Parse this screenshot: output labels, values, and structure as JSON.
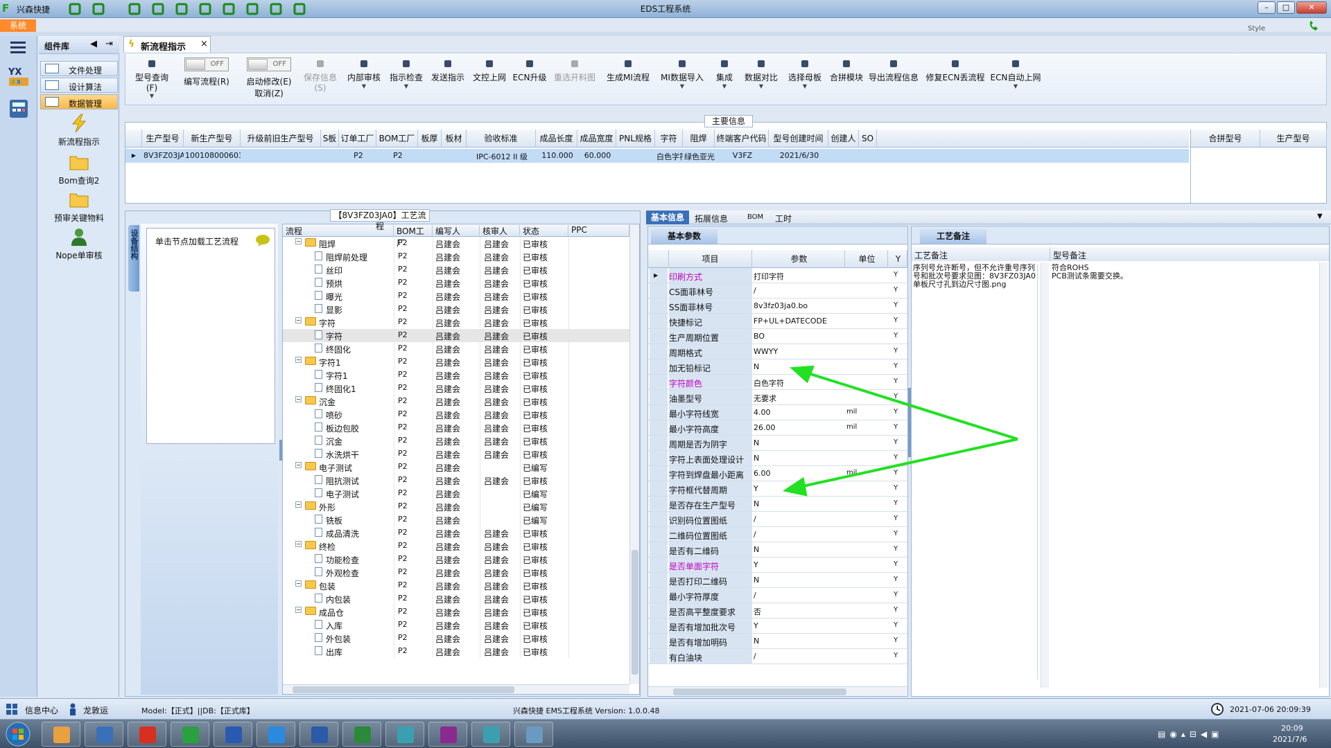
{
  "titlebar": {
    "app_name": "兴森快捷",
    "window_title": "EDS工程系统",
    "style_label": "Style",
    "buttons": [
      "–",
      "□",
      "✕"
    ]
  },
  "quick_icons": [
    "search-icon",
    "target-icon",
    "table-icon",
    "scissors-icon",
    "film-icon",
    "tree-icon",
    "grid-icon",
    "user-icon",
    "chart-icon",
    "monitor-icon"
  ],
  "system_tab": "系统",
  "nav": {
    "header": "组件库",
    "items": [
      "文件处理",
      "设计算法",
      "数据管理"
    ],
    "big_items": [
      "新流程指示",
      "Bom查询2",
      "预审关键物料",
      "Nope单审核"
    ]
  },
  "doc_tab": {
    "label": "新流程指示",
    "close": "×"
  },
  "toolbar": {
    "buttons": [
      {
        "label": "型号查询(F)",
        "icon": "search-icon",
        "dropdown": true
      },
      {
        "label": "编写流程(R)",
        "toggle": "OFF"
      },
      {
        "label": "启动修改(E)",
        "toggle": "OFF",
        "sub": "取消(Z)"
      },
      {
        "label": "保存信息(S)",
        "icon": "check-icon",
        "disabled": true
      },
      {
        "label": "内部审核",
        "icon": "printer-icon",
        "dropdown": true
      },
      {
        "label": "指示检查",
        "icon": "check-icon",
        "dropdown": true
      },
      {
        "label": "发送指示",
        "icon": "upload-icon"
      },
      {
        "label": "文控上网",
        "icon": "cloud-icon"
      },
      {
        "label": "ECN升级",
        "icon": "bolt-icon"
      },
      {
        "label": "重选开料图",
        "icon": "image-icon",
        "disabled": true
      },
      {
        "label": "生成MI流程",
        "icon": "gears-icon"
      },
      {
        "label": "MI数据导入",
        "icon": "import-icon",
        "dropdown": true
      },
      {
        "label": "集成",
        "icon": "download-icon",
        "dropdown": true
      },
      {
        "label": "数据对比",
        "icon": "wand-icon",
        "dropdown": true
      },
      {
        "label": "选择母板",
        "icon": "shuffle-icon",
        "dropdown": true
      },
      {
        "label": "合拼模块",
        "icon": "list-icon"
      },
      {
        "label": "导出流程信息",
        "icon": "smile-icon"
      },
      {
        "label": "修复ECN丢流程",
        "icon": "wrench-icon"
      },
      {
        "label": "ECN自动上网",
        "icon": "star-icon",
        "dropdown": true
      }
    ]
  },
  "main_info": {
    "legend": "主要信息",
    "columns": [
      "生产型号",
      "新生产型号",
      "升级前旧生产型号",
      "S板",
      "订单工厂",
      "BOM工厂",
      "板厚",
      "板材",
      "验收标准",
      "成品长度",
      "成品宽度",
      "PNL规格",
      "字符",
      "阻焊",
      "终端客户代码",
      "型号创建时间",
      "创建人",
      "SO"
    ],
    "row": [
      "8V3FZ03JA0",
      "10010800060309",
      "",
      "",
      "P2",
      "P2",
      "",
      "",
      "IPC-6012 II 级",
      "110.000",
      "60.000",
      "",
      "白色字符",
      "绿色亚光",
      "V3FZ",
      "2021/6/30",
      "",
      ""
    ],
    "side_columns": [
      "合拼型号",
      "生产型号"
    ]
  },
  "process": {
    "legend": "【8V3FZ03JA0】工艺流程",
    "side_title": "设备结构",
    "hint": "单击节点加载工艺流程",
    "columns": [
      "流程",
      "BOM工厂",
      "编写人",
      "核审人",
      "状态",
      "PPC"
    ],
    "rows": [
      {
        "name": "阻焊",
        "level": 0,
        "factory": "P2",
        "writer": "吕建会",
        "reviewer": "吕建会",
        "status": "已审核"
      },
      {
        "name": "阻焊前处理",
        "level": 1,
        "factory": "P2",
        "writer": "吕建会",
        "reviewer": "吕建会",
        "status": "已审核"
      },
      {
        "name": "丝印",
        "level": 1,
        "factory": "P2",
        "writer": "吕建会",
        "reviewer": "吕建会",
        "status": "已审核"
      },
      {
        "name": "预烘",
        "level": 1,
        "factory": "P2",
        "writer": "吕建会",
        "reviewer": "吕建会",
        "status": "已审核"
      },
      {
        "name": "曝光",
        "level": 1,
        "factory": "P2",
        "writer": "吕建会",
        "reviewer": "吕建会",
        "status": "已审核"
      },
      {
        "name": "显影",
        "level": 1,
        "factory": "P2",
        "writer": "吕建会",
        "reviewer": "吕建会",
        "status": "已审核"
      },
      {
        "name": "字符",
        "level": 0,
        "factory": "P2",
        "writer": "吕建会",
        "reviewer": "吕建会",
        "status": "已审核"
      },
      {
        "name": "字符",
        "level": 1,
        "factory": "P2",
        "writer": "吕建会",
        "reviewer": "吕建会",
        "status": "已审核",
        "selected": true
      },
      {
        "name": "终固化",
        "level": 1,
        "factory": "P2",
        "writer": "吕建会",
        "reviewer": "吕建会",
        "status": "已审核"
      },
      {
        "name": "字符1",
        "level": 0,
        "factory": "P2",
        "writer": "吕建会",
        "reviewer": "吕建会",
        "status": "已审核"
      },
      {
        "name": "字符1",
        "level": 1,
        "factory": "P2",
        "writer": "吕建会",
        "reviewer": "吕建会",
        "status": "已审核"
      },
      {
        "name": "终固化1",
        "level": 1,
        "factory": "P2",
        "writer": "吕建会",
        "reviewer": "吕建会",
        "status": "已审核"
      },
      {
        "name": "沉金",
        "level": 0,
        "factory": "P2",
        "writer": "吕建会",
        "reviewer": "吕建会",
        "status": "已审核"
      },
      {
        "name": "喷砂",
        "level": 1,
        "factory": "P2",
        "writer": "吕建会",
        "reviewer": "吕建会",
        "status": "已审核"
      },
      {
        "name": "板边包胶",
        "level": 1,
        "factory": "P2",
        "writer": "吕建会",
        "reviewer": "吕建会",
        "status": "已审核"
      },
      {
        "name": "沉金",
        "level": 1,
        "factory": "P2",
        "writer": "吕建会",
        "reviewer": "吕建会",
        "status": "已审核"
      },
      {
        "name": "水洗烘干",
        "level": 1,
        "factory": "P2",
        "writer": "吕建会",
        "reviewer": "吕建会",
        "status": "已审核"
      },
      {
        "name": "电子测试",
        "level": 0,
        "factory": "P2",
        "writer": "吕建会",
        "reviewer": "",
        "status": "已编写"
      },
      {
        "name": "阻抗测试",
        "level": 1,
        "factory": "P2",
        "writer": "吕建会",
        "reviewer": "吕建会",
        "status": "已审核"
      },
      {
        "name": "电子测试",
        "level": 1,
        "factory": "P2",
        "writer": "吕建会",
        "reviewer": "",
        "status": "已编写"
      },
      {
        "name": "外形",
        "level": 0,
        "factory": "P2",
        "writer": "吕建会",
        "reviewer": "",
        "status": "已编写"
      },
      {
        "name": "铣板",
        "level": 1,
        "factory": "P2",
        "writer": "吕建会",
        "reviewer": "",
        "status": "已编写"
      },
      {
        "name": "成品清洗",
        "level": 1,
        "factory": "P2",
        "writer": "吕建会",
        "reviewer": "吕建会",
        "status": "已审核"
      },
      {
        "name": "终检",
        "level": 0,
        "factory": "P2",
        "writer": "吕建会",
        "reviewer": "吕建会",
        "status": "已审核"
      },
      {
        "name": "功能检查",
        "level": 1,
        "factory": "P2",
        "writer": "吕建会",
        "reviewer": "吕建会",
        "status": "已审核"
      },
      {
        "name": "外观检查",
        "level": 1,
        "factory": "P2",
        "writer": "吕建会",
        "reviewer": "吕建会",
        "status": "已审核"
      },
      {
        "name": "包装",
        "level": 0,
        "factory": "P2",
        "writer": "吕建会",
        "reviewer": "吕建会",
        "status": "已审核"
      },
      {
        "name": "内包装",
        "level": 1,
        "factory": "P2",
        "writer": "吕建会",
        "reviewer": "吕建会",
        "status": "已审核"
      },
      {
        "name": "成品仓",
        "level": 0,
        "factory": "P2",
        "writer": "吕建会",
        "reviewer": "吕建会",
        "status": "已审核"
      },
      {
        "name": "入库",
        "level": 1,
        "factory": "P2",
        "writer": "吕建会",
        "reviewer": "吕建会",
        "status": "已审核"
      },
      {
        "name": "外包装",
        "level": 1,
        "factory": "P2",
        "writer": "吕建会",
        "reviewer": "吕建会",
        "status": "已审核"
      },
      {
        "name": "出库",
        "level": 1,
        "factory": "P2",
        "writer": "吕建会",
        "reviewer": "吕建会",
        "status": "已审核"
      }
    ]
  },
  "detail_tabs": [
    "基本信息",
    "拓展信息",
    "BOM",
    "工时"
  ],
  "params": {
    "subtab": "基本参数",
    "columns": [
      "项目",
      "参数",
      "单位",
      "Y"
    ],
    "rows": [
      {
        "name": "印刷方式",
        "value": "打印字符",
        "unit": "",
        "flag": "Y",
        "highlight": true
      },
      {
        "name": "CS面菲林号",
        "value": "/",
        "unit": "",
        "flag": "Y"
      },
      {
        "name": "SS面菲林号",
        "value": "8v3fz03ja0.bo",
        "unit": "",
        "flag": "Y"
      },
      {
        "name": "快捷标记",
        "value": "FP+UL+DATECODE",
        "unit": "",
        "flag": "Y"
      },
      {
        "name": "生产周期位置",
        "value": "BO",
        "unit": "",
        "flag": "Y"
      },
      {
        "name": "周期格式",
        "value": "WWYY",
        "unit": "",
        "flag": "Y"
      },
      {
        "name": "加无铅标记",
        "value": "N",
        "unit": "",
        "flag": "Y"
      },
      {
        "name": "字符颜色",
        "value": "白色字符",
        "unit": "",
        "flag": "Y",
        "highlight": true
      },
      {
        "name": "油墨型号",
        "value": "无要求",
        "unit": "",
        "flag": "Y"
      },
      {
        "name": "最小字符线宽",
        "value": "4.00",
        "unit": "mil",
        "flag": "Y"
      },
      {
        "name": "最小字符高度",
        "value": "26.00",
        "unit": "mil",
        "flag": "Y"
      },
      {
        "name": "周期是否为阴字",
        "value": "N",
        "unit": "",
        "flag": "Y"
      },
      {
        "name": "字符上表面处理设计",
        "value": "N",
        "unit": "",
        "flag": "Y"
      },
      {
        "name": "字符到焊盘最小距离",
        "value": "6.00",
        "unit": "mil",
        "flag": "Y"
      },
      {
        "name": "字符框代替周期",
        "value": "Y",
        "unit": "",
        "flag": "Y"
      },
      {
        "name": "是否存在生产型号",
        "value": "N",
        "unit": "",
        "flag": "Y"
      },
      {
        "name": "识别码位置图纸",
        "value": "/",
        "unit": "",
        "flag": "Y"
      },
      {
        "name": "二维码位置图纸",
        "value": "/",
        "unit": "",
        "flag": "Y"
      },
      {
        "name": "是否有二维码",
        "value": "N",
        "unit": "",
        "flag": "Y"
      },
      {
        "name": "是否单面字符",
        "value": "Y",
        "unit": "",
        "flag": "Y",
        "highlight": true
      },
      {
        "name": "是否打印二维码",
        "value": "N",
        "unit": "",
        "flag": "Y"
      },
      {
        "name": "最小字符厚度",
        "value": "/",
        "unit": "",
        "flag": "Y"
      },
      {
        "name": "是否高平整度要求",
        "value": "否",
        "unit": "",
        "flag": "Y"
      },
      {
        "name": "是否有增加批次号",
        "value": "Y",
        "unit": "",
        "flag": "Y"
      },
      {
        "name": "是否有增加明码",
        "value": "N",
        "unit": "",
        "flag": "Y"
      },
      {
        "name": "有白油块",
        "value": "/",
        "unit": "",
        "flag": "Y"
      }
    ]
  },
  "notes": {
    "tab": "工艺备注",
    "col1_title": "工艺备注",
    "col2_title": "型号备注",
    "col1_text": "序列号允许断号，但不允许重号序列号和批次号要求见图：8V3FZ03JA0单板尺寸孔到边尺寸图.png",
    "col2_text": "符合ROHS\nPCB测试条需要交换。"
  },
  "status": {
    "left": "信息中心",
    "user": "龙敦运",
    "model": "Model:【正式】||DB:【正式库】",
    "version": "兴森快捷 EMS工程系统 Version: 1.0.0.48",
    "datetime": "2021-07-06 20:09:39"
  },
  "taskbar": {
    "time": "20:09",
    "date": "2021/7/6",
    "apps": [
      "start-orb",
      "shell-icon",
      "notepad-icon",
      "refresh-app-icon",
      "p-app-icon",
      "save-app-icon",
      "bird-app-icon",
      "word-icon",
      "excel-icon",
      "eye-app-icon",
      "x-app-icon",
      "car-app-icon",
      "cube-app-icon"
    ]
  },
  "colors": {
    "accent": "#f9b94a",
    "selection": "#c3dcf6",
    "arrow": "#22e022",
    "highlight_text": "#c000c0"
  }
}
